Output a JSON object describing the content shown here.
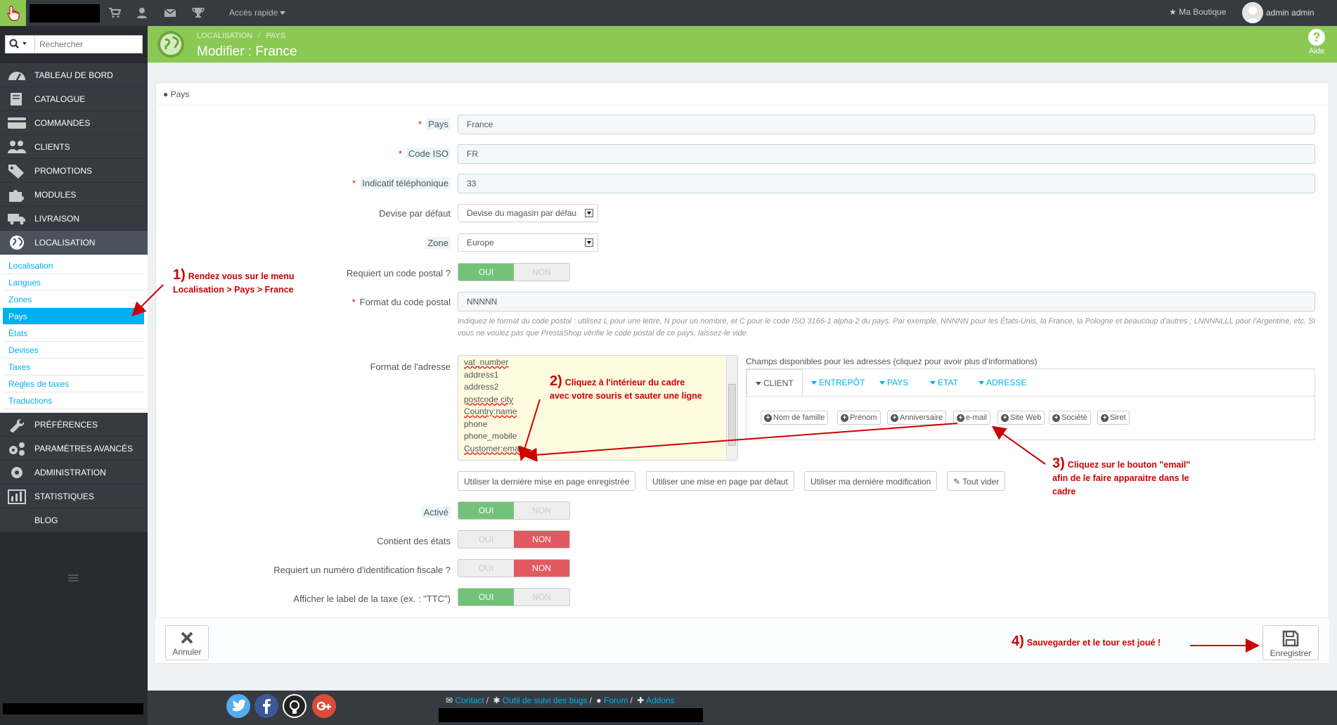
{
  "topbar": {
    "quick_access": "Accès rapide",
    "shop": "Ma Boutique",
    "user": "admin admin"
  },
  "search": {
    "placeholder": "Rechercher"
  },
  "sidebar": {
    "items": [
      {
        "label": "TABLEAU DE BORD",
        "icon": "dashboard-icon"
      },
      {
        "label": "CATALOGUE",
        "icon": "book-icon"
      },
      {
        "label": "COMMANDES",
        "icon": "credit-card-icon"
      },
      {
        "label": "CLIENTS",
        "icon": "users-icon"
      },
      {
        "label": "PROMOTIONS",
        "icon": "tags-icon"
      },
      {
        "label": "MODULES",
        "icon": "puzzle-icon"
      },
      {
        "label": "LIVRAISON",
        "icon": "truck-icon"
      },
      {
        "label": "LOCALISATION",
        "icon": "globe-icon"
      },
      {
        "label": "PRÉFÉRENCES",
        "icon": "wrench-icon"
      },
      {
        "label": "PARAMÈTRES AVANCÉS",
        "icon": "cogs-icon"
      },
      {
        "label": "ADMINISTRATION",
        "icon": "gear-icon"
      },
      {
        "label": "STATISTIQUES",
        "icon": "bar-chart-icon"
      },
      {
        "label": "BLOG",
        "icon": ""
      }
    ],
    "submenu": [
      "Localisation",
      "Langues",
      "Zones",
      "Pays",
      "États",
      "Devises",
      "Taxes",
      "Règles de taxes",
      "Traductions"
    ]
  },
  "header": {
    "crumb1": "LOCALISATION",
    "crumb2": "PAYS",
    "title": "Modifier : France",
    "help": "Aide"
  },
  "panel": {
    "title": "Pays"
  },
  "form": {
    "pays_label": "Pays",
    "pays_value": "France",
    "iso_label": "Code ISO",
    "iso_value": "FR",
    "phone_label": "Indicatif téléphonique",
    "phone_value": "33",
    "currency_label": "Devise par défaut",
    "currency_value": "Devise du magasin par défau",
    "zone_label": "Zone",
    "zone_value": "Europe",
    "need_zip_label": "Requiert un code postal ?",
    "zip_format_label": "Format du code postal",
    "zip_format_value": "NNNNN",
    "zip_help": "Indiquez le format du code postal : utilisez L pour une lettre, N pour un nombre, et C pour le code ISO 3166-1 alpha-2 du pays. Par exemple, NNNNN pour les États-Unis, la France, la Pologne et beaucoup d'autres ; LNNNNLLL pour l'Argentine, etc. Si vous ne voulez pas que PrestaShop vérifie le code postal de ce pays, laissez-le vide.",
    "address_label": "Format de l'adresse",
    "address_lines": [
      "vat_number",
      "address1",
      "address2",
      "postcode city",
      "Country:name",
      "phone",
      "phone_mobile",
      "Customer:email"
    ],
    "available_label": "Champs disponibles pour les adresses (cliquez pour avoir plus d'informations)",
    "tabs": [
      "CLIENT",
      "ENTREPÔT",
      "PAYS",
      "ETAT",
      "ADRESSE"
    ],
    "field_buttons": [
      "Nom de famille",
      "Prénom",
      "Anniversaire",
      "e-mail",
      "Site Web",
      "Société",
      "Siret"
    ],
    "layout_buttons": [
      "Utiliser la dernière mise en page enregistrée",
      "Utiliser une mise en page par défaut",
      "Utiliser ma dernière modification",
      "Tout vider"
    ],
    "active_label": "Activé",
    "states_label": "Contient des états",
    "vat_label": "Requiert un numéro d'identification fiscale ?",
    "tax_label": "Afficher le label de la taxe (ex. : \"TTC\")",
    "yes": "OUI",
    "no": "NON"
  },
  "actions": {
    "cancel": "Annuler",
    "save": "Enregistrer"
  },
  "annotations": {
    "a1_num": "1)",
    "a1_l1": "Rendez vous sur le menu",
    "a1_l2": "Localisation > Pays > France",
    "a2_num": "2)",
    "a2_l1": "Cliquez à l'intérieur du cadre",
    "a2_l2": "avec votre souris et sauter une ligne",
    "a3_num": "3)",
    "a3_l1": "Cliquez sur le bouton \"email\"",
    "a3_l2": "afin de le faire apparaitre dans le",
    "a3_l3": "cadre",
    "a4_num": "4)",
    "a4_l1": "Sauvegarder et le tour est joué !"
  },
  "footer": {
    "contact": "Contact",
    "bugs": "Outil de suivi des bugs",
    "forum": "Forum",
    "addons": "Addons"
  },
  "colors": {
    "green": "#8bc954",
    "sidebar": "#363a41",
    "link": "#00aff0",
    "annotation": "#cc0000"
  }
}
